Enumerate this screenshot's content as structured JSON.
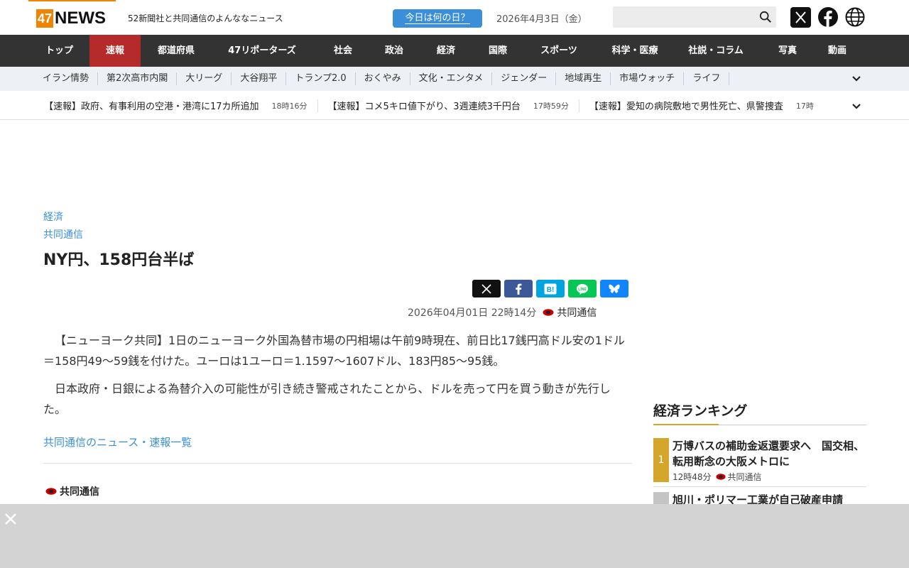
{
  "header": {
    "logo_num": "47",
    "logo_word": "NEWS",
    "tagline": "52新聞社と共同通信のよんななニュース",
    "today_button": "今日は何の日？",
    "date": "2026年4月3日（金）",
    "search_placeholder": ""
  },
  "main_nav": [
    {
      "label": "トップ",
      "width": 85
    },
    {
      "label": "速報",
      "width": 72,
      "active": true
    },
    {
      "label": "都道府県",
      "width": 100
    },
    {
      "label": "47リポーターズ",
      "width": 142
    },
    {
      "label": "社会",
      "width": 86
    },
    {
      "label": "政治",
      "width": 58
    },
    {
      "label": "経済",
      "width": 88
    },
    {
      "label": "国際",
      "width": 58
    },
    {
      "label": "スポーツ",
      "width": 114
    },
    {
      "label": "科学・医療",
      "width": 100
    },
    {
      "label": "社説・コラム",
      "width": 128
    },
    {
      "label": "写真",
      "width": 74
    },
    {
      "label": "動画",
      "width": 66
    }
  ],
  "sub_nav": [
    "イラン情勢",
    "第2次高市内閣",
    "大リーグ",
    "大谷翔平",
    "トランプ2.0",
    "おくやみ",
    "文化・エンタメ",
    "ジェンダー",
    "地域再生",
    "市場ウォッチ",
    "ライフ",
    ""
  ],
  "ticker": [
    {
      "title": "【速報】政府、有事利用の空港・港湾に17カ所追加",
      "time": "18時16分"
    },
    {
      "title": "【速報】コメ5キロ値下がり、3週連続3千円台",
      "time": "17時59分"
    },
    {
      "title": "【速報】愛知の病院敷地で男性死亡、県警捜査",
      "time": "17時"
    }
  ],
  "article": {
    "category": "経済",
    "source": "共同通信",
    "headline": "NY円、158円台半ば",
    "timestamp": "2026年04月01日 22時14分",
    "publisher": "共同通信",
    "paragraphs": [
      "【ニューヨーク共同】1日のニューヨーク外国為替市場の円相場は午前9時現在、前日比17銭円高ドル安の1ドル＝158円49～59銭を付けた。ユーロは1ユーロ＝1.1597～1607ドル、183円85～95銭。",
      "日本政府・日銀による為替介入の可能性が引き続き警戒されたことから、ドルを売って円を買う動きが先行した。"
    ],
    "more_link": "共同通信のニュース・速報一覧",
    "footer_publisher": "共同通信"
  },
  "share_buttons": [
    {
      "name": "x-share-button",
      "icon": "x-icon",
      "color": "#111111"
    },
    {
      "name": "facebook-share-button",
      "icon": "facebook-icon",
      "color": "#3b5998"
    },
    {
      "name": "hatena-share-button",
      "icon": "hatena-icon",
      "color": "#00a4de"
    },
    {
      "name": "line-share-button",
      "icon": "line-icon",
      "color": "#06c755"
    },
    {
      "name": "bluesky-share-button",
      "icon": "bluesky-icon",
      "color": "#1185fe"
    }
  ],
  "ranking": {
    "title": "経済ランキング",
    "items": [
      {
        "rank": "1",
        "title": "万博バスの補助金返還要求へ　国交相、転用断念の大阪メトロに",
        "time": "12時48分",
        "publisher": "共同通信"
      },
      {
        "rank": "",
        "title": "旭川・ポリマー工業が自己破産申請",
        "time": "",
        "publisher": ""
      }
    ]
  },
  "colors": {
    "accent_orange": "#f08300",
    "nav_bg": "#333333",
    "nav_active": "#b52a2a",
    "link_blue": "#3a8fd8",
    "rank_gold": "#d4a72c"
  }
}
